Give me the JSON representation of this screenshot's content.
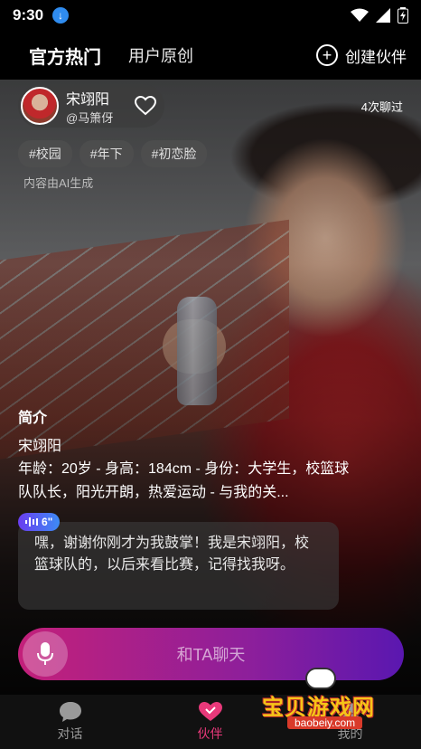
{
  "status_bar": {
    "time": "9:30"
  },
  "header": {
    "tabs": [
      {
        "label": "官方热门",
        "active": true
      },
      {
        "label": "用户原创",
        "active": false
      }
    ],
    "create_label": "创建伙伴"
  },
  "profile": {
    "name": "宋翊阳",
    "handle": "@马箫伢",
    "chat_count": "4次聊过"
  },
  "tags": [
    "#校园",
    "#年下",
    "#初恋脸"
  ],
  "ai_note": "内容由AI生成",
  "intro": {
    "title": "简介",
    "name": "宋翊阳",
    "description": "年龄：20岁 - 身高：184cm - 身份：大学生，校篮球队队长，阳光开朗，热爱运动 - 与我的关..."
  },
  "voice_badge": {
    "duration": "6\""
  },
  "message": "嘿，谢谢你刚才为我鼓掌！我是宋翊阳，校篮球队的，以后来看比赛，记得找我呀。",
  "chat_input": {
    "label": "和TA聊天"
  },
  "bottom_nav": [
    {
      "label": "对话",
      "icon": "chat-icon",
      "active": false
    },
    {
      "label": "伙伴",
      "icon": "partner-heart-icon",
      "active": true
    },
    {
      "label": "我的",
      "icon": "profile-icon",
      "active": false
    }
  ],
  "watermark": {
    "text": "宝贝游戏网",
    "url": "baobeiy.com"
  },
  "colors": {
    "accent_pink": "#e8397a",
    "chat_gradient_start": "#c3207a",
    "chat_gradient_end": "#5a17b0",
    "download_blue": "#2f8cf0"
  }
}
